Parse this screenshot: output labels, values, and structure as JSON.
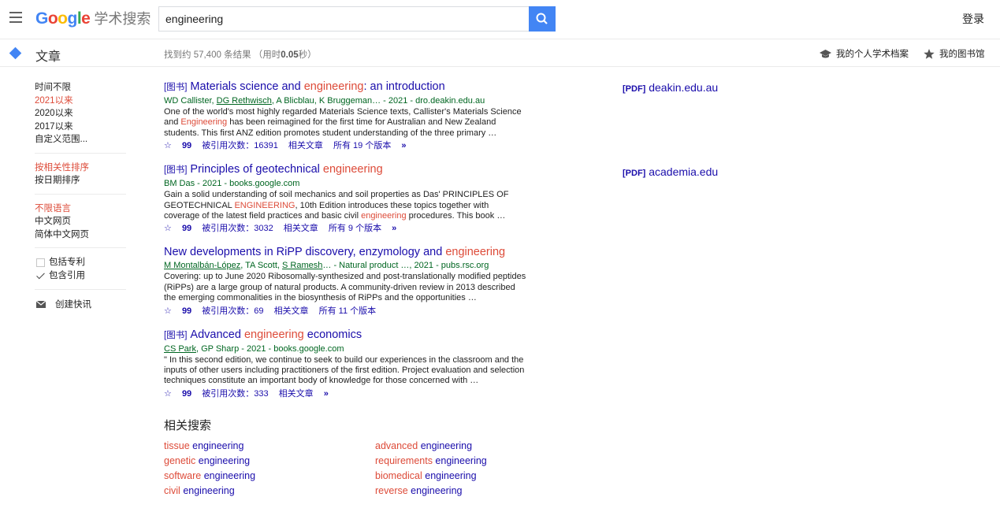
{
  "header": {
    "logo_google": [
      "G",
      "o",
      "o",
      "g",
      "l",
      "e"
    ],
    "logo_suffix": "学术搜索",
    "search_value": "engineering",
    "login": "登录"
  },
  "subbar": {
    "section": "文章",
    "stats_prefix": "找到约 57,400 条结果 （用时",
    "stats_time": "0.05",
    "stats_suffix": "秒）",
    "profile": "我的个人学术档案",
    "library": "我的图书馆"
  },
  "sidebar": {
    "time": [
      "时间不限",
      "2021以来",
      "2020以来",
      "2017以来",
      "自定义范围..."
    ],
    "sort": [
      "按相关性排序",
      "按日期排序"
    ],
    "lang": [
      "不限语言",
      "中文网页",
      "简体中文网页"
    ],
    "include_patents": "包括专利",
    "include_citations": "包含引用",
    "create_alert": "创建快讯"
  },
  "results": [
    {
      "tag": "[图书]",
      "title_pre": "Materials science and ",
      "title_hl": "engineering",
      "title_post": ": an introduction",
      "meta_pre": "WD Callister, ",
      "meta_author_link": "DG Rethwisch",
      "meta_post": ", A Blicblau, K Bruggeman… - 2021 - dro.deakin.edu.au",
      "snippet_pre": "One of the world's most highly regarded Materials Science texts, Callister's Materials Science and ",
      "snippet_hl": "Engineering",
      "snippet_post": " has been reimagined for the first time for Australian and New Zealand students. This first ANZ edition promotes student understanding of the three primary …",
      "cited": "被引用次数：16391",
      "related": "相关文章",
      "versions": "所有 19 个版本",
      "side_pdf": "[PDF]",
      "side_domain": "deakin.edu.au"
    },
    {
      "tag": "[图书]",
      "title_pre": "Principles of geotechnical ",
      "title_hl": "engineering",
      "title_post": "",
      "meta_pre": "BM Das - 2021 - books.google.com",
      "meta_author_link": "",
      "meta_post": "",
      "snippet_pre": "Gain a solid understanding of soil mechanics and soil properties as Das' PRINCIPLES OF GEOTECHNICAL ",
      "snippet_hl": "ENGINEERING",
      "snippet_mid": ", 10th Edition introduces these topics together with coverage of the latest field practices and basic civil ",
      "snippet_hl2": "engineering",
      "snippet_post": " procedures. This book …",
      "cited": "被引用次数：3032",
      "related": "相关文章",
      "versions": "所有 9 个版本",
      "side_pdf": "[PDF]",
      "side_domain": "academia.edu"
    },
    {
      "tag": "",
      "title_pre": "New developments in RiPP discovery, enzymology and ",
      "title_hl": "engineering",
      "title_post": "",
      "meta_a1": "M Montalbán-López",
      "meta_mid": ", TA Scott, ",
      "meta_a2": "S Ramesh",
      "meta_post": "… - Natural product …, 2021 - pubs.rsc.org",
      "snippet_pre": "Covering: up to June 2020 Ribosomally-synthesized and post-translationally modified peptides (RiPPs) are a large group of natural products. A community-driven review in 2013 described the emerging commonalities in the biosynthesis of RiPPs and the opportunities …",
      "cited": "被引用次数：69",
      "related": "相关文章",
      "versions": "所有 11 个版本"
    },
    {
      "tag": "[图书]",
      "title_pre": "Advanced ",
      "title_hl": "engineering",
      "title_post": " economics",
      "meta_author_link": "CS Park",
      "meta_post": ", GP Sharp - 2021 - books.google.com",
      "snippet_pre": "\" In this second edition, we continue to seek to build our experiences in the classroom and the inputs of other users including practitioners of the first edition. Project evaluation and selection techniques constitute an important body of knowledge for those concerned with …",
      "cited": "被引用次数：333",
      "related": "相关文章"
    }
  ],
  "related_searches": {
    "title": "相关搜索",
    "items": [
      {
        "pre": "tissue",
        "post": " engineering"
      },
      {
        "pre": "advanced",
        "post": " engineering"
      },
      {
        "pre": "genetic",
        "post": " engineering"
      },
      {
        "pre": "requirements",
        "post": " engineering"
      },
      {
        "pre": "software",
        "post": " engineering"
      },
      {
        "pre": "biomedical",
        "post": " engineering"
      },
      {
        "pre": "civil",
        "post": " engineering"
      },
      {
        "pre": "reverse",
        "post": " engineering"
      }
    ]
  },
  "colors": {
    "link": "#1a0dab",
    "highlight": "#dd4b39",
    "meta": "#006621",
    "accent": "#4285f4"
  },
  "icons": [
    "menu-icon",
    "search-icon",
    "mortarboard-icon",
    "star-icon",
    "diamond-icon",
    "mail-icon",
    "quote-icon",
    "more-icon"
  ]
}
